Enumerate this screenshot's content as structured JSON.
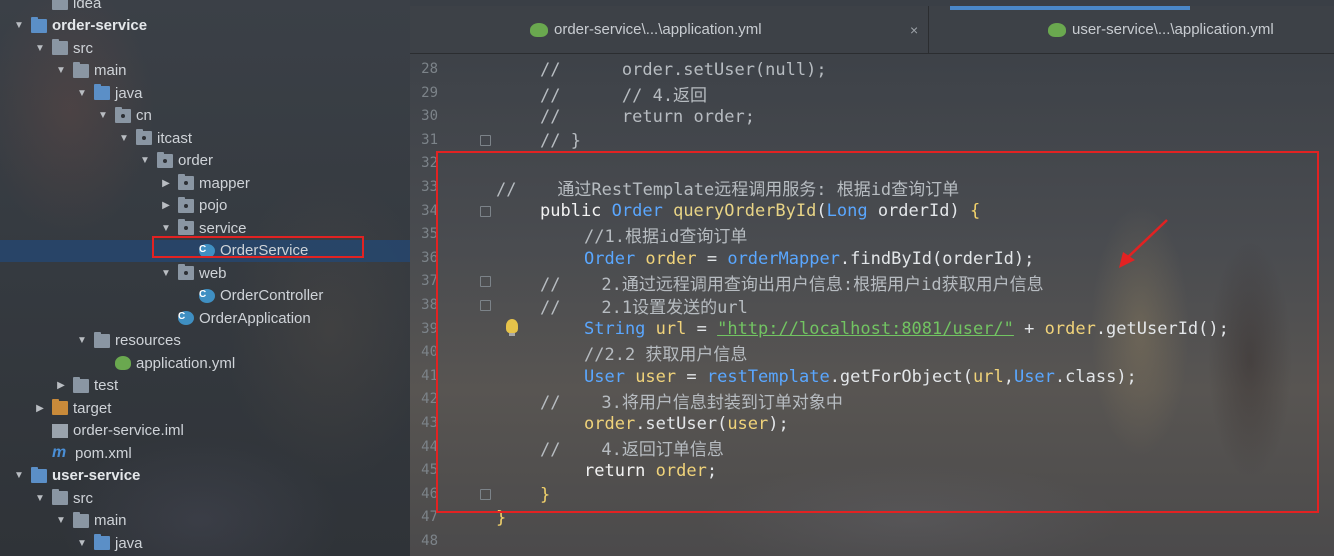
{
  "project_tree": {
    "items": [
      {
        "label": "idea",
        "icon": "folder-icon",
        "indent": 2
      },
      {
        "label": "order-service",
        "icon": "module-folder-icon",
        "indent": 1,
        "bold": true
      },
      {
        "label": "src",
        "icon": "folder-icon",
        "indent": 2
      },
      {
        "label": "main",
        "icon": "folder-icon",
        "indent": 3
      },
      {
        "label": "java",
        "icon": "source-folder-icon",
        "indent": 4
      },
      {
        "label": "cn",
        "icon": "package-icon",
        "indent": 5
      },
      {
        "label": "itcast",
        "icon": "package-icon",
        "indent": 6
      },
      {
        "label": "order",
        "icon": "package-icon",
        "indent": 7
      },
      {
        "label": "mapper",
        "icon": "package-icon",
        "indent": 8
      },
      {
        "label": "pojo",
        "icon": "package-icon",
        "indent": 8
      },
      {
        "label": "service",
        "icon": "package-icon",
        "indent": 8
      },
      {
        "label": "OrderService",
        "icon": "class-icon",
        "indent": 9,
        "selected": true
      },
      {
        "label": "web",
        "icon": "package-icon",
        "indent": 8
      },
      {
        "label": "OrderController",
        "icon": "class-icon",
        "indent": 9
      },
      {
        "label": "OrderApplication",
        "icon": "spring-boot-class-icon",
        "indent": 8
      },
      {
        "label": "resources",
        "icon": "resources-folder-icon",
        "indent": 4
      },
      {
        "label": "application.yml",
        "icon": "yml-file-icon",
        "indent": 5
      },
      {
        "label": "test",
        "icon": "folder-icon",
        "indent": 3
      },
      {
        "label": "target",
        "icon": "excluded-folder-icon",
        "indent": 2
      },
      {
        "label": "order-service.iml",
        "icon": "iml-file-icon",
        "indent": 2
      },
      {
        "label": "pom.xml",
        "icon": "maven-icon",
        "indent": 2
      },
      {
        "label": "user-service",
        "icon": "module-folder-icon",
        "indent": 1,
        "bold": true
      },
      {
        "label": "src",
        "icon": "folder-icon",
        "indent": 2
      },
      {
        "label": "main",
        "icon": "folder-icon",
        "indent": 3
      },
      {
        "label": "java",
        "icon": "source-folder-icon",
        "indent": 4
      }
    ]
  },
  "tabs": [
    {
      "label": "order-service\\...\\application.yml",
      "icon": "yml-file-icon",
      "close": "×"
    },
    {
      "label": "user-service\\...\\application.yml",
      "icon": "yml-file-icon"
    }
  ],
  "editor": {
    "line_numbers": [
      "28",
      "29",
      "30",
      "31",
      "32",
      "33",
      "34",
      "35",
      "36",
      "37",
      "38",
      "39",
      "40",
      "41",
      "42",
      "43",
      "44",
      "45",
      "46",
      "47",
      "48"
    ],
    "lines": [
      [
        {
          "t": "//      order.setUser(null);",
          "c": "c"
        }
      ],
      [
        {
          "t": "//      // 4.返回",
          "c": "c"
        }
      ],
      [
        {
          "t": "//      return order;",
          "c": "c"
        }
      ],
      [
        {
          "t": "// }",
          "c": "c"
        }
      ],
      [],
      [
        {
          "t": "//    通过RestTemplate远程调用服务: 根据id查询订单",
          "c": "c"
        }
      ],
      [
        {
          "t": "public ",
          "c": "kw"
        },
        {
          "t": "Order ",
          "c": "ty"
        },
        {
          "t": "queryOrderById",
          "c": "fn"
        },
        {
          "t": "(",
          "c": "pl"
        },
        {
          "t": "Long ",
          "c": "ty"
        },
        {
          "t": "orderId",
          "c": "pl"
        },
        {
          "t": ") ",
          "c": "pl"
        },
        {
          "t": "{",
          "c": "br"
        }
      ],
      [
        {
          "t": "//1.根据id查询订单",
          "c": "c"
        }
      ],
      [
        {
          "t": "Order ",
          "c": "ty"
        },
        {
          "t": "order ",
          "c": "id"
        },
        {
          "t": "= ",
          "c": "pl"
        },
        {
          "t": "orderMapper",
          "c": "ty"
        },
        {
          "t": ".findById(orderId);",
          "c": "pl"
        }
      ],
      [
        {
          "t": "//    2.通过远程调用查询出用户信息:根据用户id获取用户信息",
          "c": "c"
        }
      ],
      [
        {
          "t": "//    2.1设置发送的url",
          "c": "c"
        }
      ],
      [
        {
          "t": "String ",
          "c": "ty"
        },
        {
          "t": "url ",
          "c": "id"
        },
        {
          "t": "= ",
          "c": "pl"
        },
        {
          "t": "\"http://localhost:8081/user/\"",
          "c": "st"
        },
        {
          "t": " + ",
          "c": "pl"
        },
        {
          "t": "order",
          "c": "id"
        },
        {
          "t": ".getUserId();",
          "c": "pl"
        }
      ],
      [
        {
          "t": "//2.2 获取用户信息",
          "c": "c"
        }
      ],
      [
        {
          "t": "User ",
          "c": "ty"
        },
        {
          "t": "user ",
          "c": "id"
        },
        {
          "t": "= ",
          "c": "pl"
        },
        {
          "t": "restTemplate",
          "c": "ty"
        },
        {
          "t": ".getForObject(",
          "c": "pl"
        },
        {
          "t": "url",
          "c": "id"
        },
        {
          "t": ",",
          "c": "pl"
        },
        {
          "t": "User",
          "c": "ty"
        },
        {
          "t": ".class);",
          "c": "pl"
        }
      ],
      [
        {
          "t": "//    3.将用户信息封装到订单对象中",
          "c": "c"
        }
      ],
      [
        {
          "t": "order",
          "c": "id"
        },
        {
          "t": ".setUser(",
          "c": "pl"
        },
        {
          "t": "user",
          "c": "id"
        },
        {
          "t": ");",
          "c": "pl"
        }
      ],
      [
        {
          "t": "//    4.返回订单信息",
          "c": "c"
        }
      ],
      [
        {
          "t": "return ",
          "c": "kw"
        },
        {
          "t": "order",
          "c": "id"
        },
        {
          "t": ";",
          "c": "pl"
        }
      ],
      [
        {
          "t": "}",
          "c": "br"
        }
      ],
      [
        {
          "t": "}",
          "c": "br"
        }
      ],
      []
    ]
  },
  "colors": {
    "highlight_box": "#e22222",
    "comment": "#b7bcc1",
    "type": "#5aa7ff",
    "identifier": "#f0d37a",
    "string": "#72c462"
  }
}
